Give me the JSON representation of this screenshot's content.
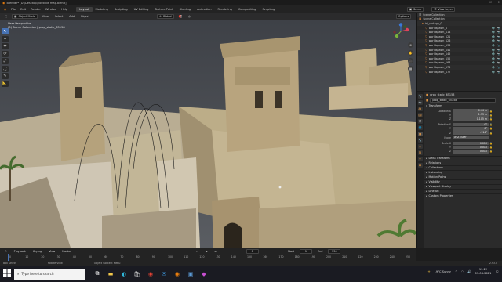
{
  "window": {
    "title": "Blender* [D:\\Desktop\\youtube map.blend]",
    "controls": [
      "—",
      "☐",
      "✕"
    ]
  },
  "menus": [
    "File",
    "Edit",
    "Render",
    "Window",
    "Help"
  ],
  "workspaces": [
    "Layout",
    "Modeling",
    "Sculpting",
    "UV Editing",
    "Texture Paint",
    "Shading",
    "Animation",
    "Rendering",
    "Compositing",
    "Scripting"
  ],
  "active_workspace": "Layout",
  "top": {
    "scene": "Scene",
    "view_layer": "View Layer"
  },
  "viewport": {
    "header": {
      "mode": "Object Mode",
      "menus": [
        "View",
        "Select",
        "Add",
        "Object"
      ],
      "orientation": "Global",
      "overlay": "Options"
    },
    "info_line1": "User Perspective",
    "info_line2": "(0) Scene Collection | prop_static_65158",
    "tools": [
      "⌖",
      "↖",
      "✥",
      "⟳",
      "⤢",
      "⛶",
      "✎",
      "📐"
    ]
  },
  "outliner": {
    "header": "Scene Collection",
    "rows": [
      {
        "label": "Scene Collection",
        "icon": "▣"
      },
      {
        "label": "ini_vintage_0",
        "icon": "▾"
      },
      {
        "label": "worldspawn_0",
        "icon": "▽"
      },
      {
        "label": "worldspawn_114",
        "icon": "▽"
      },
      {
        "label": "worldspawn_121",
        "icon": "▽"
      },
      {
        "label": "worldspawn_126",
        "icon": "▽"
      },
      {
        "label": "worldspawn_130",
        "icon": "▽"
      },
      {
        "label": "worldspawn_141",
        "icon": "▽"
      },
      {
        "label": "worldspawn_145",
        "icon": "▽"
      },
      {
        "label": "worldspawn_152",
        "icon": "▽"
      },
      {
        "label": "worldspawn_163",
        "icon": "▽"
      },
      {
        "label": "worldspawn_170",
        "icon": "▽"
      },
      {
        "label": "worldspawn_177",
        "icon": "▽"
      }
    ]
  },
  "properties": {
    "object_name": "prop_static_65158",
    "object_field": "prop_static_65158",
    "transform_label": "Transform",
    "location": [
      {
        "axis": "Location X",
        "value": "0.44 m"
      },
      {
        "axis": "Y",
        "value": "1.33 m"
      },
      {
        "axis": "Z",
        "value": "0.105 m"
      }
    ],
    "rotation": [
      {
        "axis": "Rotation X",
        "value": "0°"
      },
      {
        "axis": "Y",
        "value": "0°"
      },
      {
        "axis": "Z",
        "value": "-114°"
      }
    ],
    "mode": {
      "label": "Mode",
      "value": "XYZ Euler"
    },
    "scale": [
      {
        "axis": "Scale X",
        "value": "0.010"
      },
      {
        "axis": "Y",
        "value": "0.010"
      },
      {
        "axis": "Z",
        "value": "0.010"
      }
    ],
    "sections": [
      "Delta Transform",
      "Relations",
      "Collections",
      "Instancing",
      "Motion Paths",
      "Visibility",
      "Viewport Display",
      "Line Art",
      "Custom Properties"
    ]
  },
  "timeline": {
    "menus": [
      "Playback",
      "Keying",
      "View",
      "Marker"
    ],
    "start_label": "Start",
    "start": "1",
    "end_label": "End",
    "end": "250",
    "current": "0",
    "ticks": [
      "0",
      "10",
      "20",
      "30",
      "40",
      "50",
      "60",
      "70",
      "80",
      "90",
      "100",
      "110",
      "120",
      "130",
      "140",
      "150",
      "160",
      "170",
      "180",
      "190",
      "200",
      "210",
      "220",
      "230",
      "240",
      "250"
    ]
  },
  "status": {
    "left": "Box Select",
    "mid": "Rotate View",
    "right": "Object Context Menu",
    "version": "2.93.0"
  },
  "taskbar": {
    "search_placeholder": "Type here to search",
    "weather": "19°C Sunny",
    "time": "19:22",
    "date": "07-08-2021"
  }
}
